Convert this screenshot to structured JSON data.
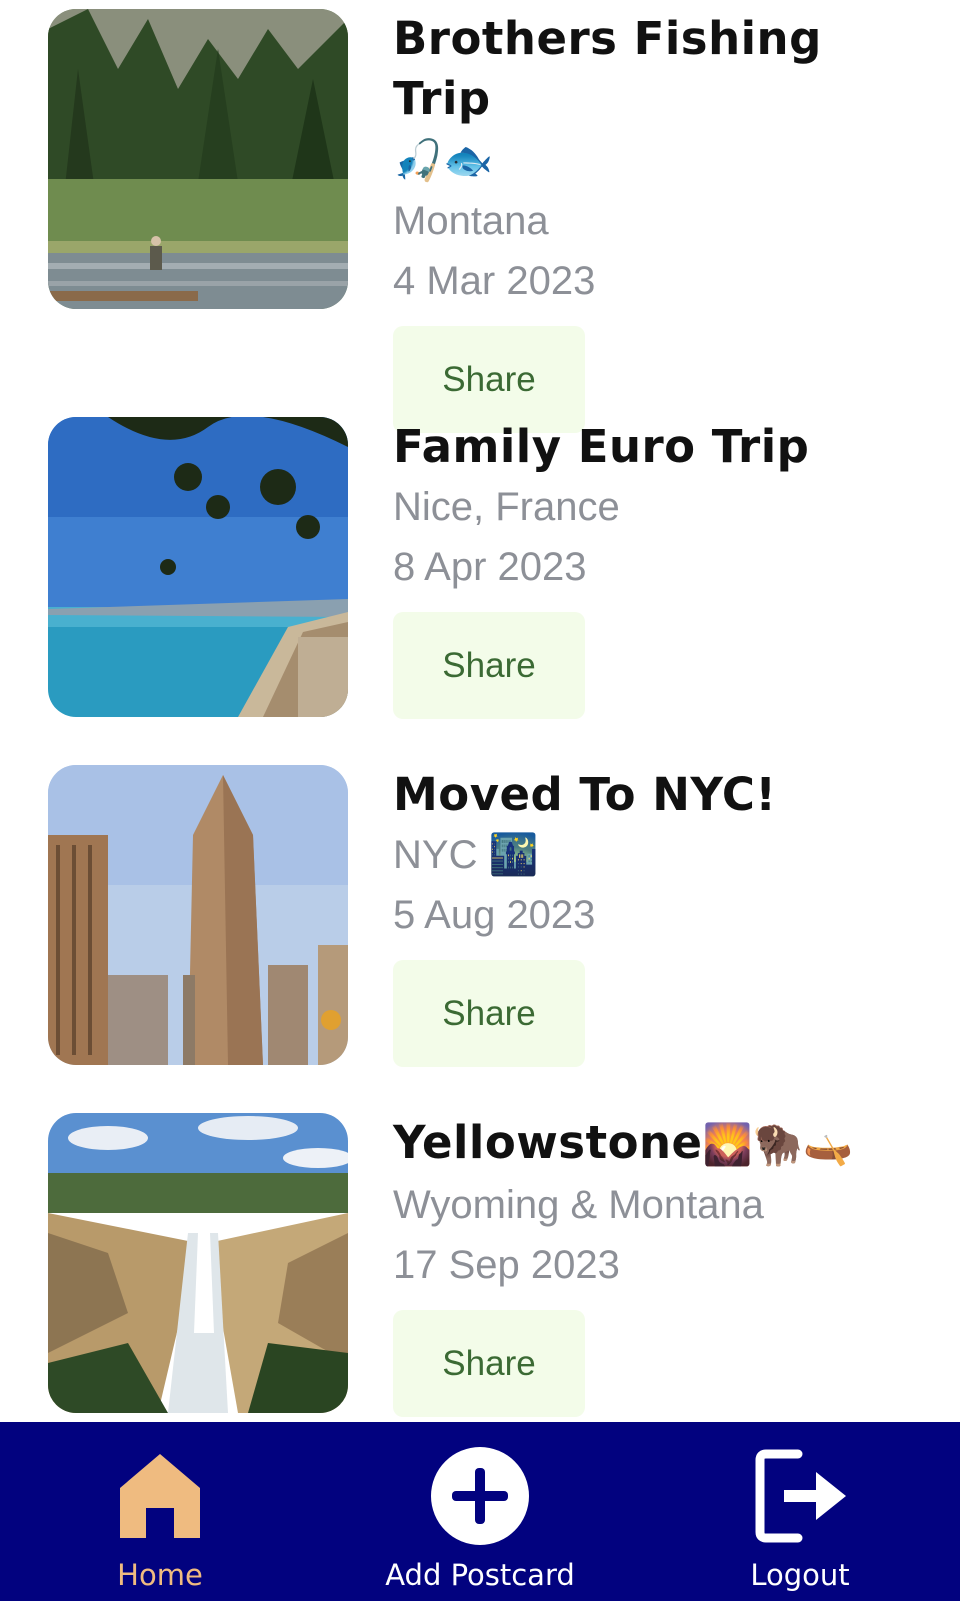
{
  "trips": [
    {
      "title": "Brothers Fishing Trip",
      "title_emoji": "🎣🐟",
      "location": "Montana",
      "date": "4 Mar 2023",
      "share_label": "Share",
      "image_icon": "river-fishing-photo"
    },
    {
      "title": "Family Euro Trip",
      "location": "Nice, France",
      "date": "8 Apr 2023",
      "share_label": "Share",
      "image_icon": "coastline-photo"
    },
    {
      "title": "Moved To NYC!",
      "location": "NYC",
      "location_emoji": "🌃",
      "date": "5 Aug 2023",
      "share_label": "Share",
      "image_icon": "flatiron-building-photo"
    },
    {
      "title": "Yellowstone",
      "title_emoji": "🌄🦬🛶",
      "location": "Wyoming & Montana",
      "date": "17 Sep 2023",
      "share_label": "Share",
      "image_icon": "waterfall-canyon-photo"
    }
  ],
  "nav": {
    "home": {
      "label": "Home",
      "icon": "home-icon"
    },
    "add": {
      "label": "Add Postcard",
      "icon": "add-circle-icon"
    },
    "logout": {
      "label": "Logout",
      "icon": "logout-icon"
    }
  },
  "colors": {
    "nav_bg": "#02027f",
    "active": "#efbb80",
    "share_bg": "#f3fce9",
    "share_text": "#3b6a34",
    "meta_text": "#8d9097"
  }
}
